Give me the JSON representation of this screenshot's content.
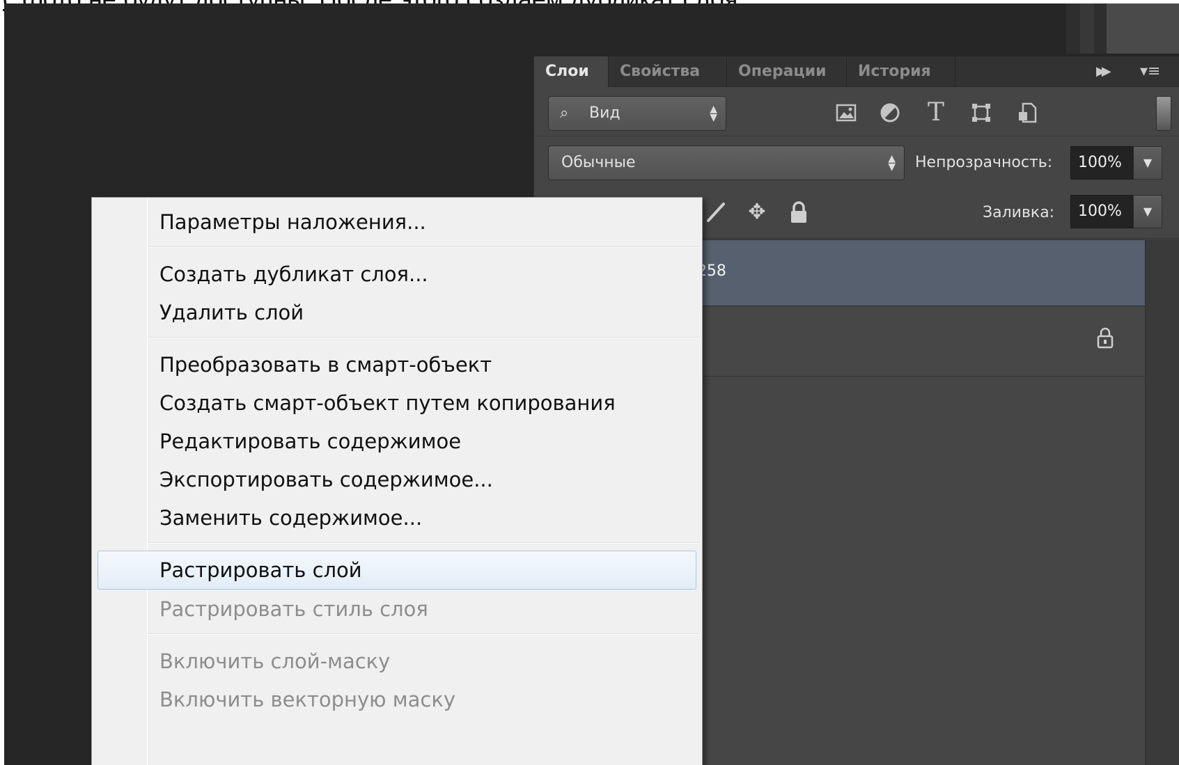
{
  "caption": "с фото не будут доступны. После этого создаем дубликат слоя",
  "layers_panel": {
    "tabs": [
      {
        "label": "Слои",
        "active": true
      },
      {
        "label": "Свойства",
        "active": false
      },
      {
        "label": "Операции",
        "active": false
      },
      {
        "label": "История",
        "active": false
      }
    ],
    "collapse_icon": "double-chevron-right-icon",
    "menu_icon": "panel-menu-icon",
    "filter": {
      "value": "Вид",
      "icons": [
        "pixel-layer-filter-icon",
        "adjustment-filter-icon",
        "type-filter-icon",
        "shape-filter-icon",
        "smart-object-filter-icon"
      ]
    },
    "blend_mode": "Обычные",
    "opacity": {
      "label": "Непрозрачность:",
      "value": "100%"
    },
    "fill": {
      "label": "Заливка:",
      "value": "100%"
    },
    "layers": [
      {
        "name_fragment": "-258",
        "selected": true
      },
      {
        "name_fragment": "",
        "locked": true
      }
    ]
  },
  "context_menu": {
    "items": [
      {
        "label": "Параметры наложения...",
        "enabled": true
      },
      {
        "label": "Создать дубликат слоя...",
        "enabled": true
      },
      {
        "label": "Удалить слой",
        "enabled": true
      },
      {
        "label": "Преобразовать в смарт-объект",
        "enabled": true
      },
      {
        "label": "Создать смарт-объект путем копирования",
        "enabled": true
      },
      {
        "label": "Редактировать содержимое",
        "enabled": true
      },
      {
        "label": "Экспортировать содержимое...",
        "enabled": true
      },
      {
        "label": "Заменить содержимое...",
        "enabled": true
      },
      {
        "label": "Растрировать слой",
        "enabled": true,
        "highlighted": true
      },
      {
        "label": "Растрировать стиль слоя",
        "enabled": false
      },
      {
        "label": "Включить слой-маску",
        "enabled": false
      },
      {
        "label": "Включить векторную маску",
        "enabled": false
      }
    ]
  },
  "colors": {
    "workspace": "#262626",
    "panel": "#454545",
    "selected_layer": "#56606f",
    "menu_background": "#f0f0f0",
    "menu_highlight_border": "#a9c5e6"
  }
}
